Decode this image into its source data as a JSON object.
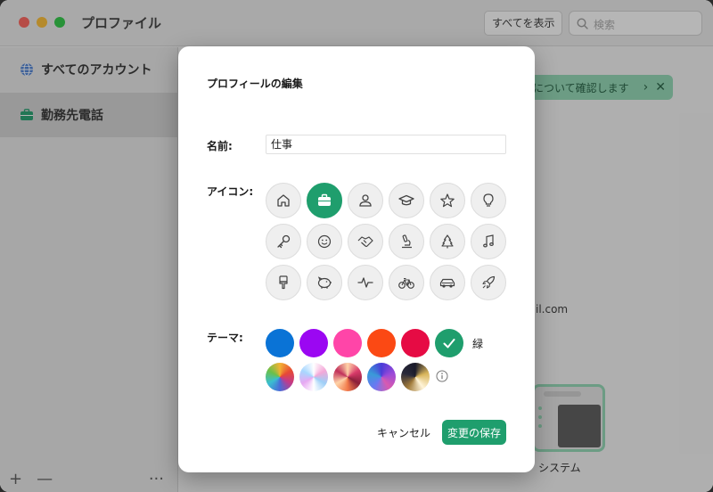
{
  "window": {
    "title": "プロファイル",
    "show_all_label": "すべてを表示",
    "search_placeholder": "検索"
  },
  "sidebar": {
    "items": [
      {
        "label": "すべてのアカウント",
        "icon": "globe-icon"
      },
      {
        "label": "勤務先電話",
        "icon": "briefcase-icon",
        "active": true
      }
    ],
    "add_label": "+",
    "remove_label": "—",
    "more_label": "···"
  },
  "main": {
    "banner_text": "について確認します",
    "banner_chevron": "›",
    "banner_close": "✕",
    "email_partial": "il.com",
    "theme_option_label": "システム"
  },
  "modal": {
    "title": "プロフィールの編集",
    "name_label": "名前:",
    "name_value": "仕事",
    "icon_label": "アイコン:",
    "icons": [
      "house-icon",
      "briefcase-icon",
      "person-icon",
      "graduation-cap-icon",
      "star-icon",
      "lightbulb-icon",
      "key-icon",
      "smiley-icon",
      "handshake-icon",
      "microscope-icon",
      "tree-icon",
      "music-note-icon",
      "paintbrush-icon",
      "piggy-bank-icon",
      "pulse-icon",
      "bicycle-icon",
      "car-icon",
      "rocket-icon"
    ],
    "selected_icon": "briefcase-icon",
    "theme_label": "テーマ:",
    "theme_selected_name": "緑",
    "solid_colors": [
      "#0a73d6",
      "#9b07f2",
      "#ff45a8",
      "#fb4914",
      "#e60b44",
      "#1f9e6d"
    ],
    "selected_color": "#1f9e6d",
    "cancel_label": "キャンセル",
    "save_label": "変更の保存"
  }
}
